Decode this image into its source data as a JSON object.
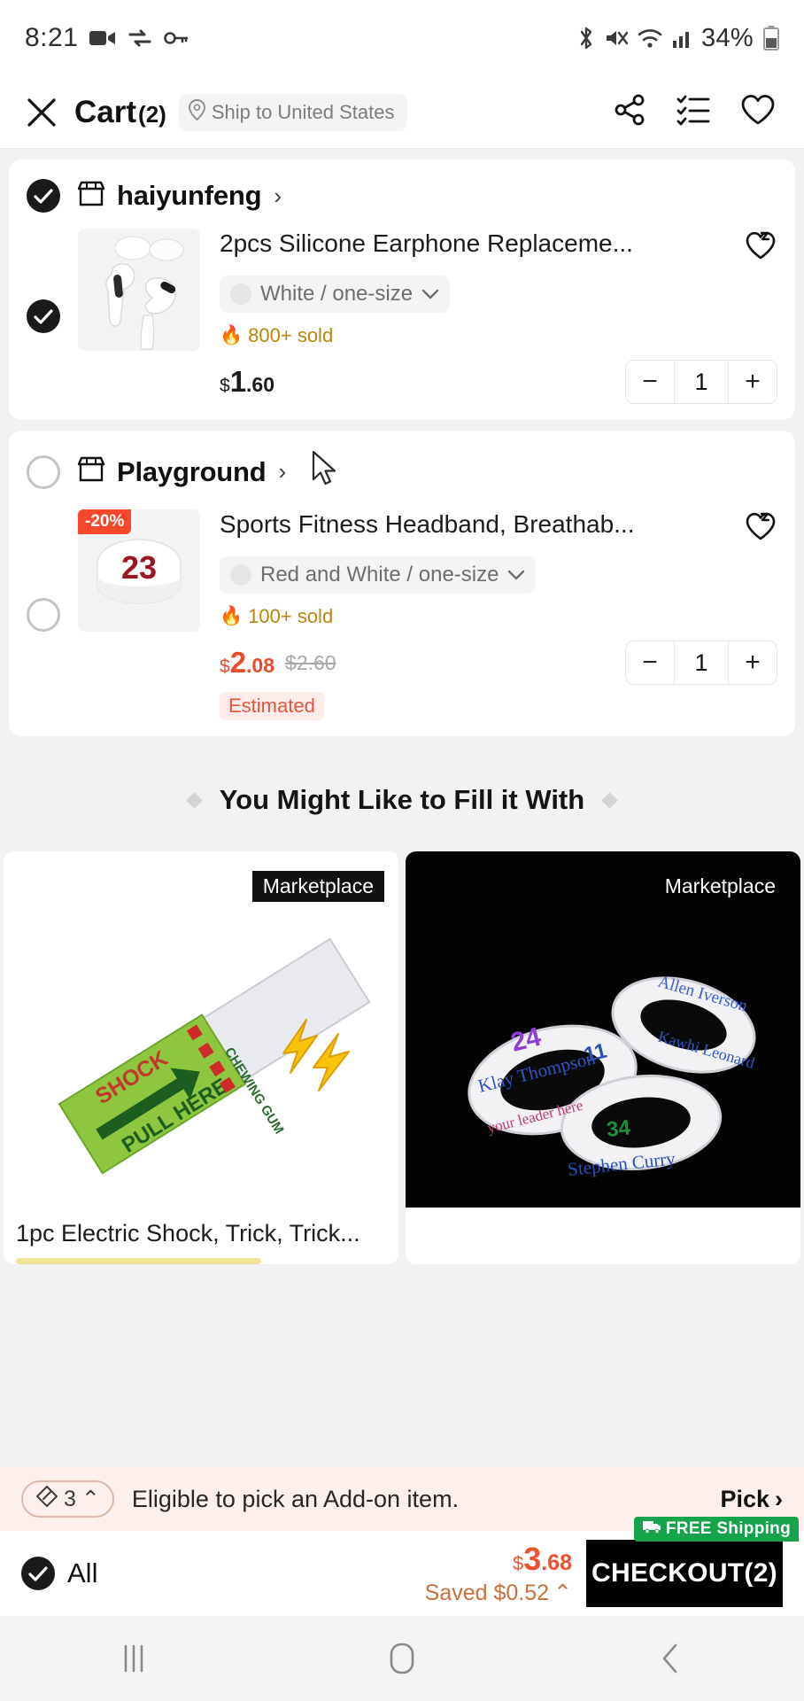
{
  "status_bar": {
    "time": "8:21",
    "battery_percent": "34%",
    "left_icons": [
      "camera-record-icon",
      "vpn-key-exchange-icon",
      "key-icon"
    ],
    "right_icons": [
      "bluetooth-icon",
      "mute-icon",
      "wifi-icon",
      "cellular-signal-icon",
      "battery-icon"
    ]
  },
  "header": {
    "close_icon": "close-icon",
    "title": "Cart",
    "count": "(2)",
    "ship_to": "Ship to United States",
    "location_icon": "location-pin-icon",
    "actions": [
      {
        "name": "share-icon"
      },
      {
        "name": "order-list-icon"
      },
      {
        "name": "wishlist-heart-icon"
      }
    ]
  },
  "stores": [
    {
      "name": "haiyunfeng",
      "selected": true,
      "store_icon": "storefront-icon",
      "arrow": "›",
      "item": {
        "selected": true,
        "title": "2pcs Silicone Earphone Replaceme...",
        "variant": "White / one-size",
        "variant_caret": "⌄",
        "sold": "800+ sold",
        "flame_icon": "flame-icon",
        "price_currency": "$",
        "price_int": "1",
        "price_dec": ".60",
        "old_price": "",
        "discount_badge": "",
        "estimated": "",
        "qty": "1",
        "minus": "−",
        "plus": "+",
        "wishlist_icon": "heart-add-icon",
        "thumb": "earphone-thumbnail"
      }
    },
    {
      "name": "Playground",
      "selected": false,
      "store_icon": "storefront-icon",
      "arrow": "›",
      "item": {
        "selected": false,
        "title": "Sports Fitness Headband, Breathab...",
        "variant": "Red and White / one-size",
        "variant_caret": "⌄",
        "sold": "100+ sold",
        "flame_icon": "flame-icon",
        "price_currency": "$",
        "price_int": "2",
        "price_dec": ".08",
        "old_price": "$2.60",
        "discount_badge": "-20%",
        "estimated": "Estimated",
        "qty": "1",
        "minus": "−",
        "plus": "+",
        "wishlist_icon": "heart-add-icon",
        "thumb": "headband-thumbnail",
        "thumb_number": "23"
      }
    }
  ],
  "recommendations": {
    "heading": "You Might Like to Fill it With",
    "cards": [
      {
        "badge": "Marketplace",
        "name": "1pc Electric Shock, Trick, Trick...",
        "image": "electric-shock-gum-image"
      },
      {
        "badge": "Marketplace",
        "name": "",
        "image": "basketball-wristbands-image",
        "image_texts": [
          "24",
          "Klay Thompson",
          "11",
          "Allen Iverson",
          "Kawhi Leonard",
          "34",
          "Stephen Curry",
          "your leader here"
        ]
      }
    ]
  },
  "addon_bar": {
    "coupon_count": "3",
    "coupon_caret": "⌃",
    "tag_icon": "coupon-tag-icon",
    "message": "Eligible to pick an Add-on item.",
    "pick_label": "Pick",
    "pick_arrow": "›"
  },
  "checkout_bar": {
    "all_selected": true,
    "all_label": "All",
    "total_currency": "$",
    "total_int": "3",
    "total_dec": ".68",
    "saved_label": "Saved $0.52",
    "saved_caret": "⌃",
    "checkout_label": "CHECKOUT(2)",
    "free_shipping": "FREE Shipping",
    "truck_icon": "delivery-truck-icon"
  },
  "nav_bar": {
    "recents_icon": "recents-icon",
    "home_icon": "home-icon",
    "back_icon": "back-icon"
  },
  "colors": {
    "accent_red": "#ea4b2a",
    "badge_red": "#f5472c",
    "green": "#16a34a",
    "gold": "#b8860b"
  }
}
